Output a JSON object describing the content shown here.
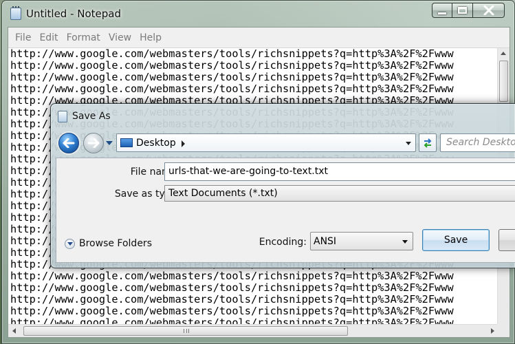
{
  "notepad": {
    "title": "Untitled - Notepad",
    "menu": [
      "File",
      "Edit",
      "Format",
      "View",
      "Help"
    ],
    "lines": [
      "http://www.google.com/webmasters/tools/richsnippets?q=http%3A%2F%2Fwww",
      "http://www.google.com/webmasters/tools/richsnippets?q=http%3A%2F%2Fwww",
      "http://www.google.com/webmasters/tools/richsnippets?q=http%3A%2F%2Fwww",
      "http://www.google.com/webmasters/tools/richsnippets?q=http%3A%2F%2Fwww",
      "http://www.google.com/webmasters/tools/richsnippets?q=http%3A%2F%2Fwww",
      "http://www.google.com/webmasters/tools/richsnippets?q=http%3A%2F%2Fwww",
      "http://www.google.com/webmasters/tools/richsnippets?q=http%3A%2F%2Fwww",
      "http://www.google.com/webmasters/tools/richsnippets?q=http%3A%2F%2Fwww",
      "http://www.google.com/webmasters/tools/richsnippets?q=http%3A%2F%2Fwww",
      "http://www.google.com/webmasters/tools/richsnippets?q=http%3A%2F%2Fwww",
      "http://www.google.com/webmasters/tools/richsnippets?q=http%3A%2F%2Fwww",
      "http://www.google.com/webmasters/tools/richsnippets?q=http%3A%2F%2Fwww",
      "http://www.google.com/webmasters/tools/richsnippets?q=http%3A%2F%2Fwww",
      "http://www.google.com/webmasters/tools/richsnippets?q=http%3A%2F%2Fwww",
      "http://www.google.com/webmasters/tools/richsnippets?q=http%3A%2F%2Fwww",
      "http://www.google.com/webmasters/tools/richsnippets?q=http%3A%2F%2Fwww",
      "http://www.google.com/webmasters/tools/richsnippets?q=http%3A%2F%2Fwww",
      "http://www.google.com/webmasters/tools/richsnippets?q=http%3A%2F%2Fwww",
      "http://www.google.com/webmasters/tools/richsnippets?q=http%3A%2F%2Fwww",
      "http://www.google.com/webmasters/tools/richsnippets?q=http%3A%2F%2Fwww",
      "http://www.google.com/webmasters/tools/richsnippets?q=http%3A%2F%2Fwww",
      "http://www.google.com/webmasters/tools/richsnippets?q=http%3A%2F%2Fwww",
      "http://www.google.com/webmasters/tools/richsnippets?q=http%3A%2F%2Fwww",
      "http://www.google.com/webmasters/tools/richsnippets?q=http%3A%2F%2Fwww"
    ]
  },
  "save_as": {
    "title": "Save As",
    "location": "Desktop",
    "search_placeholder": "Search Desktop",
    "file_name_label": "File name:",
    "file_name_value": "urls-that-we-are-going-to-text.txt",
    "save_type_label": "Save as type:",
    "save_type_value": "Text Documents (*.txt)",
    "browse_folders_label": "Browse Folders",
    "encoding_label": "Encoding:",
    "encoding_value": "ANSI",
    "save_button": "Save"
  },
  "icons": {
    "notepad": "notepad-icon",
    "back": "back-arrow-icon",
    "forward": "forward-arrow-icon",
    "folder": "desktop-folder-icon",
    "refresh": "refresh-icon"
  },
  "colors": {
    "back_button": "#2f7fd0",
    "save_button_border": "#3c7fb1"
  }
}
